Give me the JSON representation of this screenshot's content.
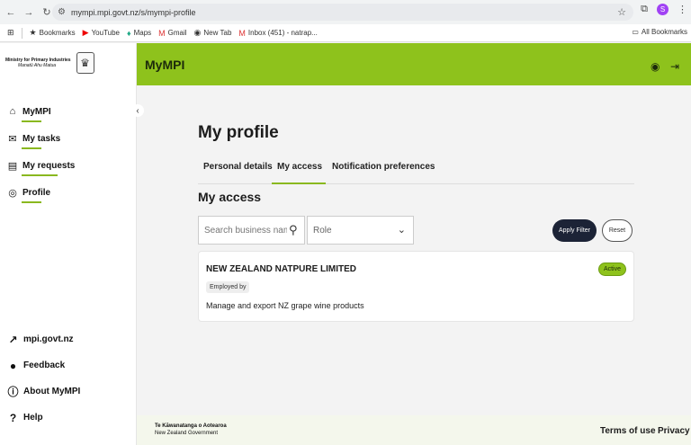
{
  "browser": {
    "url": "mympi.mpi.govt.nz/s/mympi-profile",
    "bookmarks": [
      "Bookmarks",
      "YouTube",
      "Maps",
      "Gmail",
      "New Tab",
      "Inbox (451) - natrap..."
    ],
    "all_bookmarks": "All Bookmarks",
    "profile_initial": "S"
  },
  "brand": {
    "ministry_line": "Ministry for Primary Industries",
    "maori_line": "Manatū Ahu Matua"
  },
  "header": {
    "title": "MyMPI"
  },
  "sidebar": {
    "items": [
      {
        "label": "MyMPI",
        "icon": "home-icon"
      },
      {
        "label": "My tasks",
        "icon": "mail-icon"
      },
      {
        "label": "My requests",
        "icon": "document-icon"
      },
      {
        "label": "Profile",
        "icon": "user-circle-icon"
      }
    ],
    "bottom": [
      {
        "label": "mpi.govt.nz",
        "icon": "arrow-up-right-icon"
      },
      {
        "label": "Feedback",
        "icon": "chat-icon"
      },
      {
        "label": "About MyMPI",
        "icon": "info-icon"
      },
      {
        "label": "Help",
        "icon": "help-icon"
      }
    ]
  },
  "main": {
    "page_title": "My profile",
    "tabs": [
      "Personal details",
      "My access",
      "Notification preferences"
    ],
    "active_tab": "My access",
    "section_title": "My access",
    "search_placeholder": "Search business name",
    "role_placeholder": "Role",
    "apply_label": "Apply Filter",
    "reset_label": "Reset",
    "card": {
      "title": "NEW ZEALAND NATPURE LIMITED",
      "badge": "Employed by",
      "description": "Manage and export NZ grape wine products",
      "status": "Active"
    }
  },
  "footer": {
    "brand_line1": "Te Kāwanatanga o Aotearoa",
    "brand_line2": "New Zealand Government",
    "links": [
      "Terms of use",
      "Privacy"
    ]
  },
  "colors": {
    "accent": "#8ec21c",
    "dark_button": "#1c2336"
  }
}
